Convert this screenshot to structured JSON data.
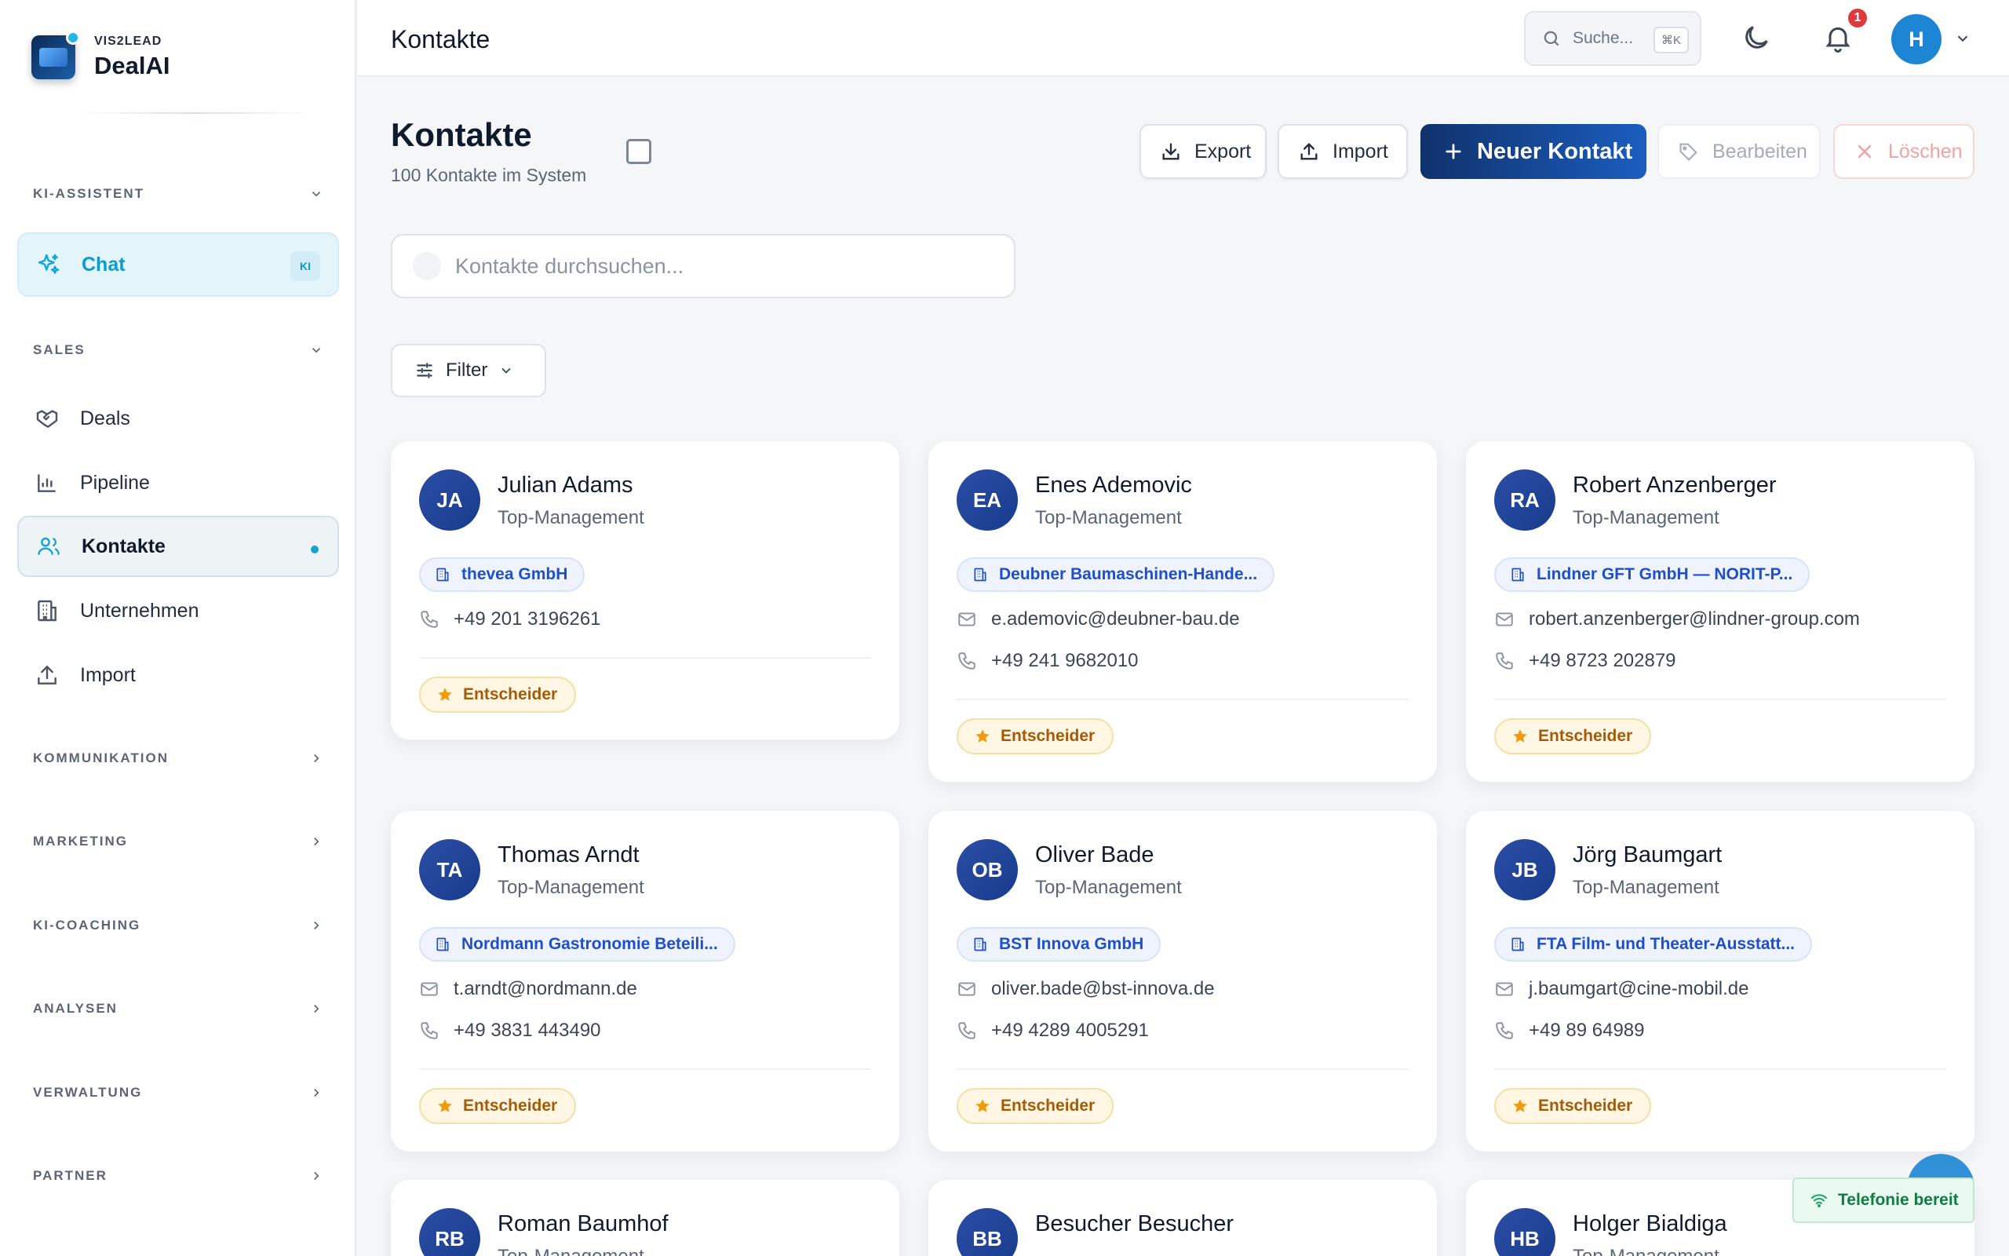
{
  "brand": {
    "sub": "VIS2LEAD",
    "name": "DealAI"
  },
  "sidebar": {
    "ki_assistent": "KI-ASSISTENT",
    "chat": {
      "label": "Chat",
      "badge": "KI"
    },
    "sales": "SALES",
    "items": [
      {
        "label": "Deals",
        "icon": "handshake-icon"
      },
      {
        "label": "Pipeline",
        "icon": "bar-chart-icon"
      },
      {
        "label": "Kontakte",
        "icon": "users-icon",
        "active": true
      },
      {
        "label": "Unternehmen",
        "icon": "building-icon"
      },
      {
        "label": "Import",
        "icon": "upload-icon"
      }
    ],
    "sections": [
      "KOMMUNIKATION",
      "MARKETING",
      "KI-COACHING",
      "ANALYSEN",
      "VERWALTUNG",
      "PARTNER"
    ]
  },
  "header": {
    "title": "Kontakte",
    "search_placeholder": "Suche...",
    "shortcut": "⌘K",
    "notifications": "1",
    "avatar_initial": "H"
  },
  "page": {
    "title": "Kontakte",
    "subtitle": "100 Kontakte im System",
    "search_placeholder": "Kontakte durchsuchen...",
    "filter": "Filter",
    "buttons": {
      "export": "Export",
      "import": "Import",
      "new": "Neuer Kontakt",
      "edit": "Bearbeiten",
      "delete": "Löschen"
    }
  },
  "contacts": [
    {
      "initials": "JA",
      "name": "Julian Adams",
      "role": "Top-Management",
      "company": "thevea GmbH",
      "email": "",
      "phone": "+49 201 3196261",
      "badge": "Entscheider"
    },
    {
      "initials": "EA",
      "name": "Enes Ademovic",
      "role": "Top-Management",
      "company": "Deubner Baumaschinen-Hande...",
      "email": "e.ademovic@deubner-bau.de",
      "phone": "+49 241 9682010",
      "badge": "Entscheider"
    },
    {
      "initials": "RA",
      "name": "Robert Anzenberger",
      "role": "Top-Management",
      "company": "Lindner GFT GmbH — NORIT-P...",
      "email": "robert.anzenberger@lindner-group.com",
      "phone": "+49 8723 202879",
      "badge": "Entscheider"
    },
    {
      "initials": "TA",
      "name": "Thomas Arndt",
      "role": "Top-Management",
      "company": "Nordmann Gastronomie Beteili...",
      "email": "t.arndt@nordmann.de",
      "phone": "+49 3831 443490",
      "badge": "Entscheider"
    },
    {
      "initials": "OB",
      "name": "Oliver Bade",
      "role": "Top-Management",
      "company": "BST Innova GmbH",
      "email": "oliver.bade@bst-innova.de",
      "phone": "+49 4289 4005291",
      "badge": "Entscheider"
    },
    {
      "initials": "JB",
      "name": "Jörg Baumgart",
      "role": "Top-Management",
      "company": "FTA Film- und Theater-Ausstatt...",
      "email": "j.baumgart@cine-mobil.de",
      "phone": "+49 89 64989",
      "badge": "Entscheider"
    },
    {
      "initials": "RB",
      "name": "Roman Baumhof",
      "role": "Top-Management"
    },
    {
      "initials": "BB",
      "name": "Besucher Besucher",
      "role": ""
    },
    {
      "initials": "HB",
      "name": "Holger Bialdiga",
      "role": "Top-Management"
    }
  ],
  "telephony": "Telefonie bereit"
}
